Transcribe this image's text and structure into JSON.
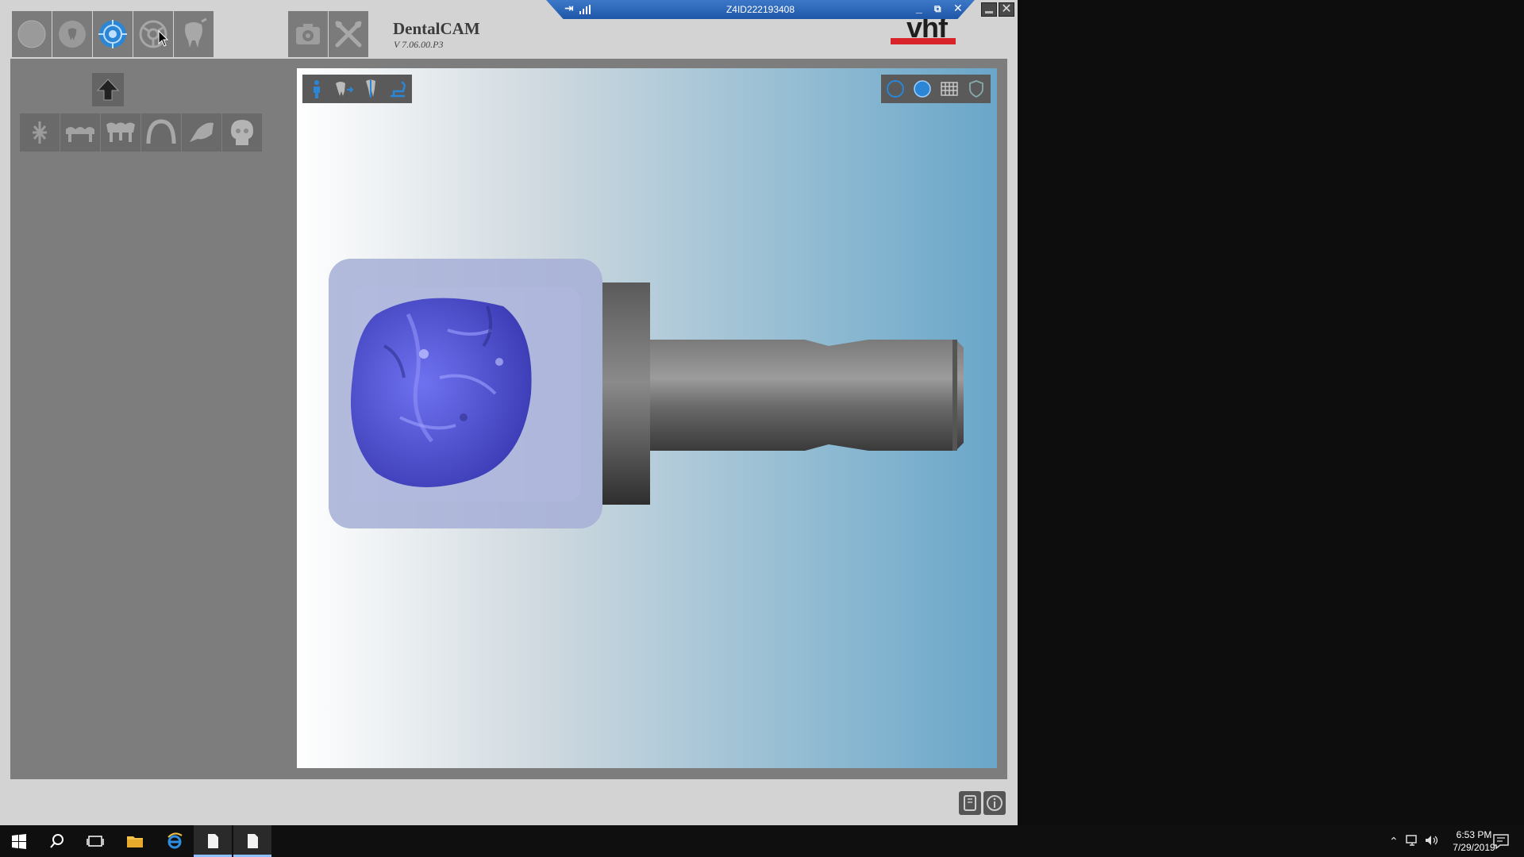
{
  "window": {
    "title": "DentalCAM",
    "version": "V 7.06.00.P3",
    "brand": "vhf"
  },
  "remote_bar": {
    "title": "Z4ID222193408",
    "pin_glyph": "⇥",
    "min_glyph": "_",
    "restore_glyph": "⧉",
    "close_glyph": "✕"
  },
  "window_controls": {
    "close_glyph": "✕"
  },
  "toolbar": {
    "buttons": [
      {
        "icon": "circle-icon"
      },
      {
        "icon": "tooth-small-icon"
      },
      {
        "icon": "target-blue-icon"
      },
      {
        "icon": "steering-wheel-icon"
      },
      {
        "icon": "tooth-large-icon"
      },
      {
        "icon": "camera-settings-icon"
      },
      {
        "icon": "tools-icon"
      }
    ]
  },
  "left_panel": {
    "up_icon": "arrow-up-icon",
    "tools": [
      {
        "icon": "implant-icon"
      },
      {
        "icon": "bridge-icon"
      },
      {
        "icon": "bridge-crowns-icon"
      },
      {
        "icon": "arch-icon"
      },
      {
        "icon": "crown-tilt-icon"
      },
      {
        "icon": "skull-icon"
      }
    ]
  },
  "viewport": {
    "left_tools": [
      "person-icon",
      "tooth-arrow-icon",
      "tooth-pin-icon",
      "chair-icon"
    ],
    "right_tools": [
      "circle-outline-icon",
      "circle-filled-icon",
      "grid-icon",
      "shield-icon"
    ]
  },
  "taskbar": {
    "time": "6:53 PM",
    "date": "7/29/2019",
    "items": [
      "windows-icon",
      "search-icon",
      "task-view-icon",
      "file-explorer-icon",
      "ie-icon",
      "document-icon",
      "document-active-icon"
    ]
  },
  "colors": {
    "accent_blue": "#2b86d6",
    "brand_red": "#d9232a",
    "crown": "#5b5ee0",
    "blank": "#a6afd6"
  }
}
